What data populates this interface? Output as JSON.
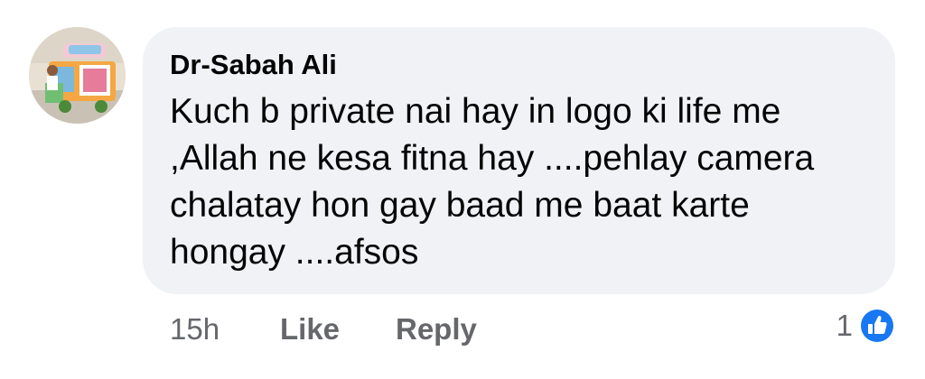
{
  "comment": {
    "author": "Dr-Sabah Ali",
    "text": "Kuch b private nai hay in logo ki life me ,Allah ne kesa fitna hay ....pehlay camera chalatay hon gay baad me baat karte hongay ....afsos",
    "time": "15h",
    "like_label": "Like",
    "reply_label": "Reply",
    "reaction_count": "1",
    "reaction_icon": "like-reaction-icon"
  },
  "colors": {
    "bubble_bg": "#f0f2f5",
    "meta_text": "#65676b",
    "like_blue": "#1877f2"
  }
}
